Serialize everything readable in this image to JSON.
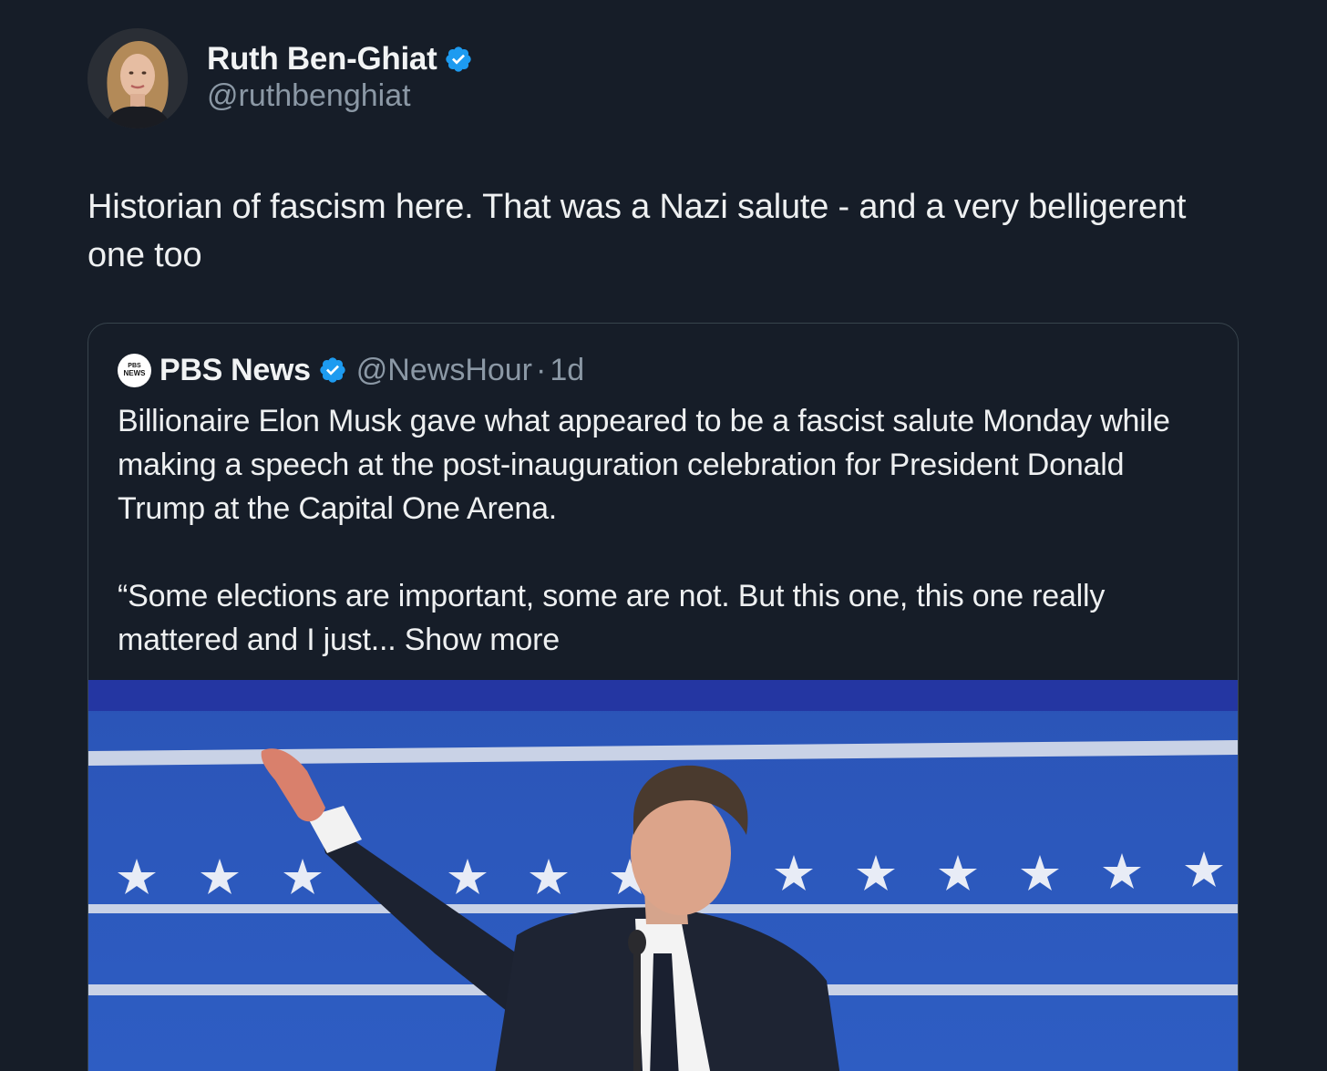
{
  "tweet": {
    "author": {
      "name": "Ruth Ben-Ghiat",
      "handle": "@ruthbenghiat",
      "verified": true
    },
    "text": "Historian of fascism here. That was a Nazi salute - and a very belligerent one too"
  },
  "quoted_tweet": {
    "author": {
      "name": "PBS News",
      "handle": "@NewsHour",
      "verified": true,
      "logo_text_top": "PBS",
      "logo_text_bottom": "NEWS"
    },
    "separator": "·",
    "time": "1d",
    "paragraph_1": "Billionaire Elon Musk gave what appeared to be a fascist salute Monday while making a speech at the post-inauguration celebration for President Donald Trump at the Capital One Arena.",
    "paragraph_2": "“Some elections are important, some are not. But this one, this one really mattered and I just...",
    "show_more": "Show more"
  },
  "colors": {
    "background": "#161d28",
    "text": "#eef0f1",
    "secondary_text": "#8b98a5",
    "verified_badge": "#1d9bf0",
    "card_border": "#38444d",
    "stage_blue": "#2a57b8"
  }
}
